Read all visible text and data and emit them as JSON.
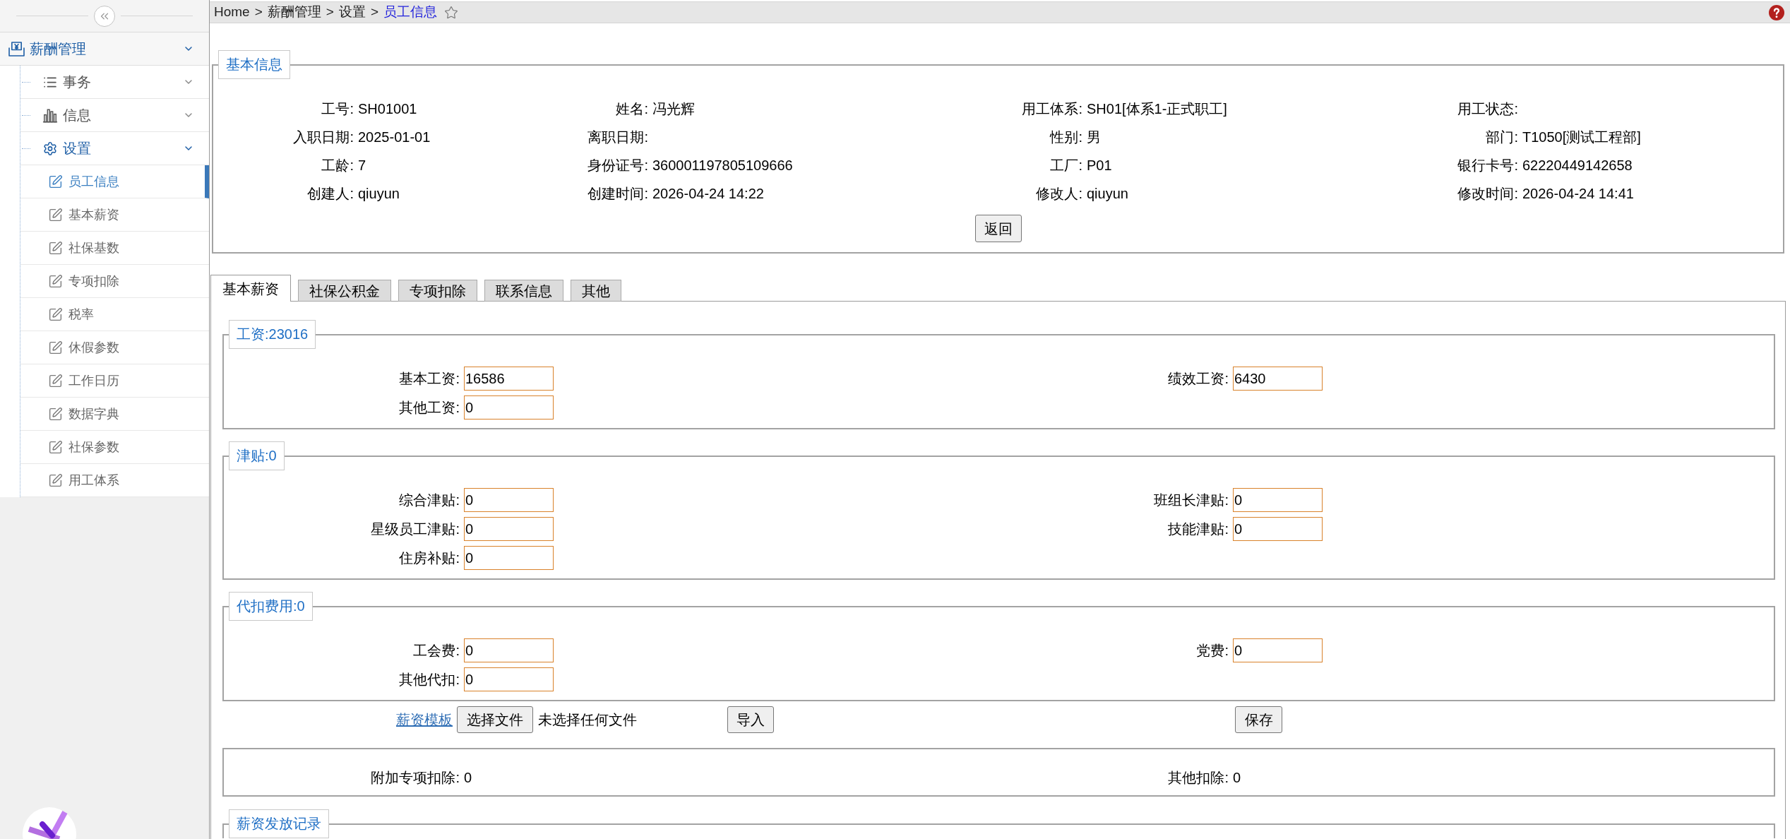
{
  "sidebar": {
    "menu": [
      {
        "label": "薪酬管理",
        "expanded": true,
        "children": [
          {
            "label": "事务",
            "expanded": false
          },
          {
            "label": "信息",
            "expanded": false
          },
          {
            "label": "设置",
            "expanded": true,
            "children": [
              {
                "label": "员工信息",
                "selected": true
              },
              {
                "label": "基本薪资",
                "selected": false
              },
              {
                "label": "社保基数",
                "selected": false
              },
              {
                "label": "专项扣除",
                "selected": false
              },
              {
                "label": "税率",
                "selected": false
              },
              {
                "label": "休假参数",
                "selected": false
              },
              {
                "label": "工作日历",
                "selected": false
              },
              {
                "label": "数据字典",
                "selected": false
              },
              {
                "label": "社保参数",
                "selected": false
              },
              {
                "label": "用工体系",
                "selected": false
              }
            ]
          }
        ]
      }
    ]
  },
  "breadcrumb": [
    {
      "kind": "link",
      "label": "Home",
      "current": false
    },
    {
      "kind": "separator",
      "label": ">"
    },
    {
      "kind": "link",
      "label": "薪酬管理",
      "current": false
    },
    {
      "kind": "separator",
      "label": ">"
    },
    {
      "kind": "link",
      "label": "设置",
      "current": false
    },
    {
      "kind": "separator",
      "label": ">"
    },
    {
      "kind": "link",
      "label": "员工信息",
      "current": true
    }
  ],
  "basic_info": {
    "legend": "基本信息",
    "fields": [
      {
        "label": "工号:",
        "value": "SH01001"
      },
      {
        "label": "姓名:",
        "value": "冯光辉"
      },
      {
        "label": "用工体系:",
        "value": "SH01[体系1-正式职工]"
      },
      {
        "label": "用工状态:"
      },
      {
        "label": "入职日期:",
        "value": "2025-01-01"
      },
      {
        "label": "离职日期:"
      },
      {
        "label": "性别:",
        "value": "男"
      },
      {
        "label": "部门:",
        "value": "T1050[测试工程部]"
      },
      {
        "label": "工龄:",
        "value": "7"
      },
      {
        "label": "身份证号:",
        "value": "360001197805109666"
      },
      {
        "label": "工厂:",
        "value": "P01"
      },
      {
        "label": "银行卡号:",
        "value": "62220449142658"
      },
      {
        "label": "创建人:",
        "value": "qiuyun"
      },
      {
        "label": "创建时间:",
        "value": "2026-04-24 14:22"
      },
      {
        "label": "修改人:",
        "value": "qiuyun"
      },
      {
        "label": "修改时间:",
        "value": "2026-04-24 14:41"
      }
    ],
    "back_button": "返回"
  },
  "tabs": [
    {
      "label": "基本薪资",
      "selected": true
    },
    {
      "label": "社保公积金",
      "selected": false
    },
    {
      "label": "专项扣除",
      "selected": false
    },
    {
      "label": "联系信息",
      "selected": false
    },
    {
      "label": "其他",
      "selected": false
    }
  ],
  "salary_sections": [
    {
      "legend": "工资:23016",
      "rows": [
        {
          "left": {
            "label": "基本工资:",
            "value": "16586"
          },
          "right": {
            "label": "绩效工资:",
            "value": "6430"
          }
        },
        {
          "left": {
            "label": "其他工资:",
            "value": "0"
          }
        }
      ]
    },
    {
      "legend": "津贴:0",
      "rows": [
        {
          "left": {
            "label": "综合津贴:",
            "value": "0"
          },
          "right": {
            "label": "班组长津贴:",
            "value": "0"
          }
        },
        {
          "left": {
            "label": "星级员工津贴:",
            "value": "0"
          },
          "right": {
            "label": "技能津贴:",
            "value": "0"
          }
        },
        {
          "left": {
            "label": "住房补贴:",
            "value": "0"
          }
        }
      ]
    },
    {
      "legend": "代扣费用:0",
      "rows": [
        {
          "left": {
            "label": "工会费:",
            "value": "0"
          },
          "right": {
            "label": "党费:",
            "value": "0"
          }
        },
        {
          "left": {
            "label": "其他代扣:",
            "value": "0"
          }
        }
      ]
    }
  ],
  "actions": {
    "template_link": "薪资模板",
    "choose_file_button": "选择文件",
    "file_status": "未选择任何文件",
    "import_button": "导入",
    "save_button": "保存"
  },
  "summary": {
    "left": {
      "label": "附加专项扣除:",
      "value": "0"
    },
    "right": {
      "label": "其他扣除:",
      "value": "0"
    }
  },
  "records": {
    "legend": "薪资发放记录"
  }
}
